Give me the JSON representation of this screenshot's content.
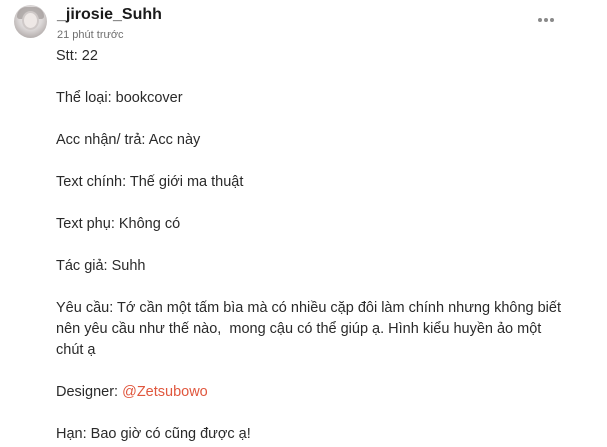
{
  "post": {
    "username": "_jirosie_Suhh",
    "timestamp": "21 phút trước",
    "lines": {
      "stt": "Stt: 22",
      "the_loai": "Thể loại: bookcover",
      "acc": "Acc nhận/ trả: Acc này",
      "text_chinh": "Text chính: Thế giới ma thuật",
      "text_phu": "Text phụ: Không có",
      "tac_gia": "Tác giả: Suhh",
      "yeu_cau_1": "Yêu cầu: Tớ cần một tấm bìa mà có nhiều cặp đôi làm chính nhưng không biết",
      "yeu_cau_2": "nên yêu cầu như thế nào,  mong cậu có thể giúp ạ. Hình kiểu huyền ảo một",
      "yeu_cau_3": "chút ạ",
      "designer_label": "Designer: ",
      "designer_mention": "@Zetsubowo",
      "han": "Hạn: Bao giờ có cũng được ạ!"
    }
  },
  "icons": {
    "more": "more-vertical-icon",
    "avatar": "user-avatar"
  },
  "colors": {
    "mention": "#e0573e",
    "text": "#2a2a2a",
    "muted": "#6f6f6f"
  }
}
